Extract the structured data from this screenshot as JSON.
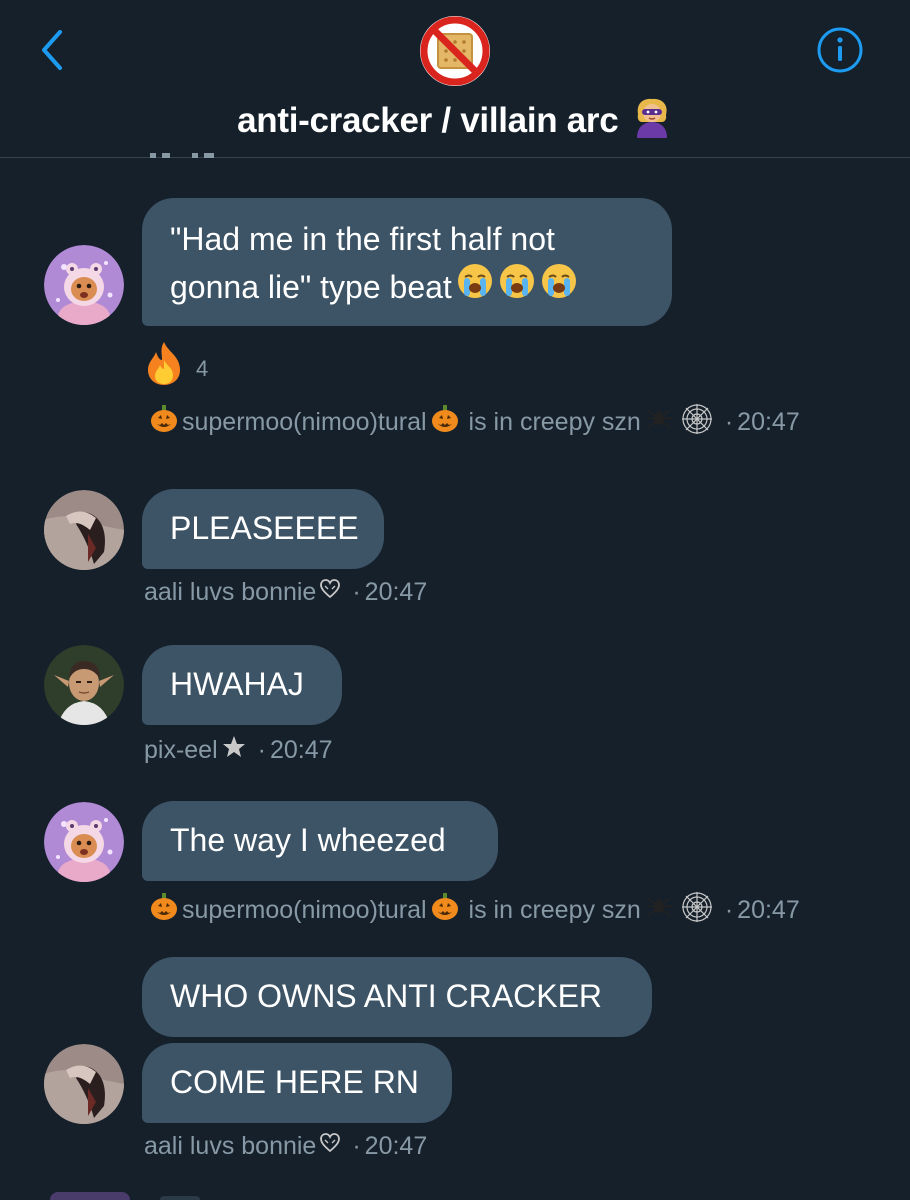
{
  "header": {
    "group_title": "anti-cracker / villain arc",
    "back_icon": "chevron-left-icon",
    "info_icon": "info-circle-icon",
    "group_avatar_icon": "no-crackers-icon",
    "title_emoji": "supervillain-emoji"
  },
  "accent": "#1d9bf0",
  "colors": {
    "background": "#15202b",
    "bubble": "#3d5466",
    "meta_text": "#8899a6"
  },
  "messages": [
    {
      "lines": [
        "\"Had me in the first half not",
        "gonna lie\" type beat"
      ],
      "emoji_after": "loudly-crying-face x3",
      "reaction": {
        "icon": "fire-emoji",
        "count": "4"
      },
      "sender": "supermoo(nimoo)tural",
      "sender_suffix": "is in creepy szn",
      "time": "20:47"
    },
    {
      "text": "PLEASEEEE",
      "sender": "aali luvs bonnie",
      "time": "20:47"
    },
    {
      "text": "HWAHAJ",
      "sender": "pix-eel",
      "time": "20:47"
    },
    {
      "text": "The way I wheezed",
      "sender": "supermoo(nimoo)tural",
      "sender_suffix": "is in creepy szn",
      "time": "20:47"
    },
    {
      "group": [
        "WHO OWNS ANTI CRACKER",
        "COME HERE RN"
      ],
      "sender": "aali luvs bonnie",
      "time": "20:47"
    }
  ],
  "separator": "·"
}
